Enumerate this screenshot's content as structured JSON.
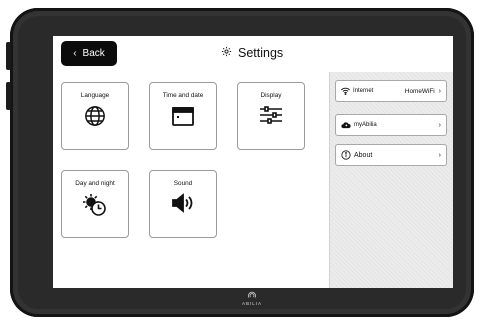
{
  "topbar": {
    "back_label": "Back",
    "title": "Settings"
  },
  "tiles": [
    {
      "label": "Language",
      "icon": "globe-icon"
    },
    {
      "label": "Time and date",
      "icon": "calendar-icon"
    },
    {
      "label": "Display",
      "icon": "sliders-icon"
    },
    {
      "label": "Day and night",
      "icon": "sun-clock-icon"
    },
    {
      "label": "Sound",
      "icon": "speaker-icon"
    }
  ],
  "side_menu": {
    "internet": {
      "label": "Internet",
      "value": "HomeWiFi",
      "icon": "wifi-icon"
    },
    "myabilia": {
      "label": "myAbilia",
      "icon": "cloud-user-icon"
    },
    "about": {
      "label": "About",
      "icon": "info-icon"
    }
  },
  "device": {
    "brand": "ABILIA"
  }
}
